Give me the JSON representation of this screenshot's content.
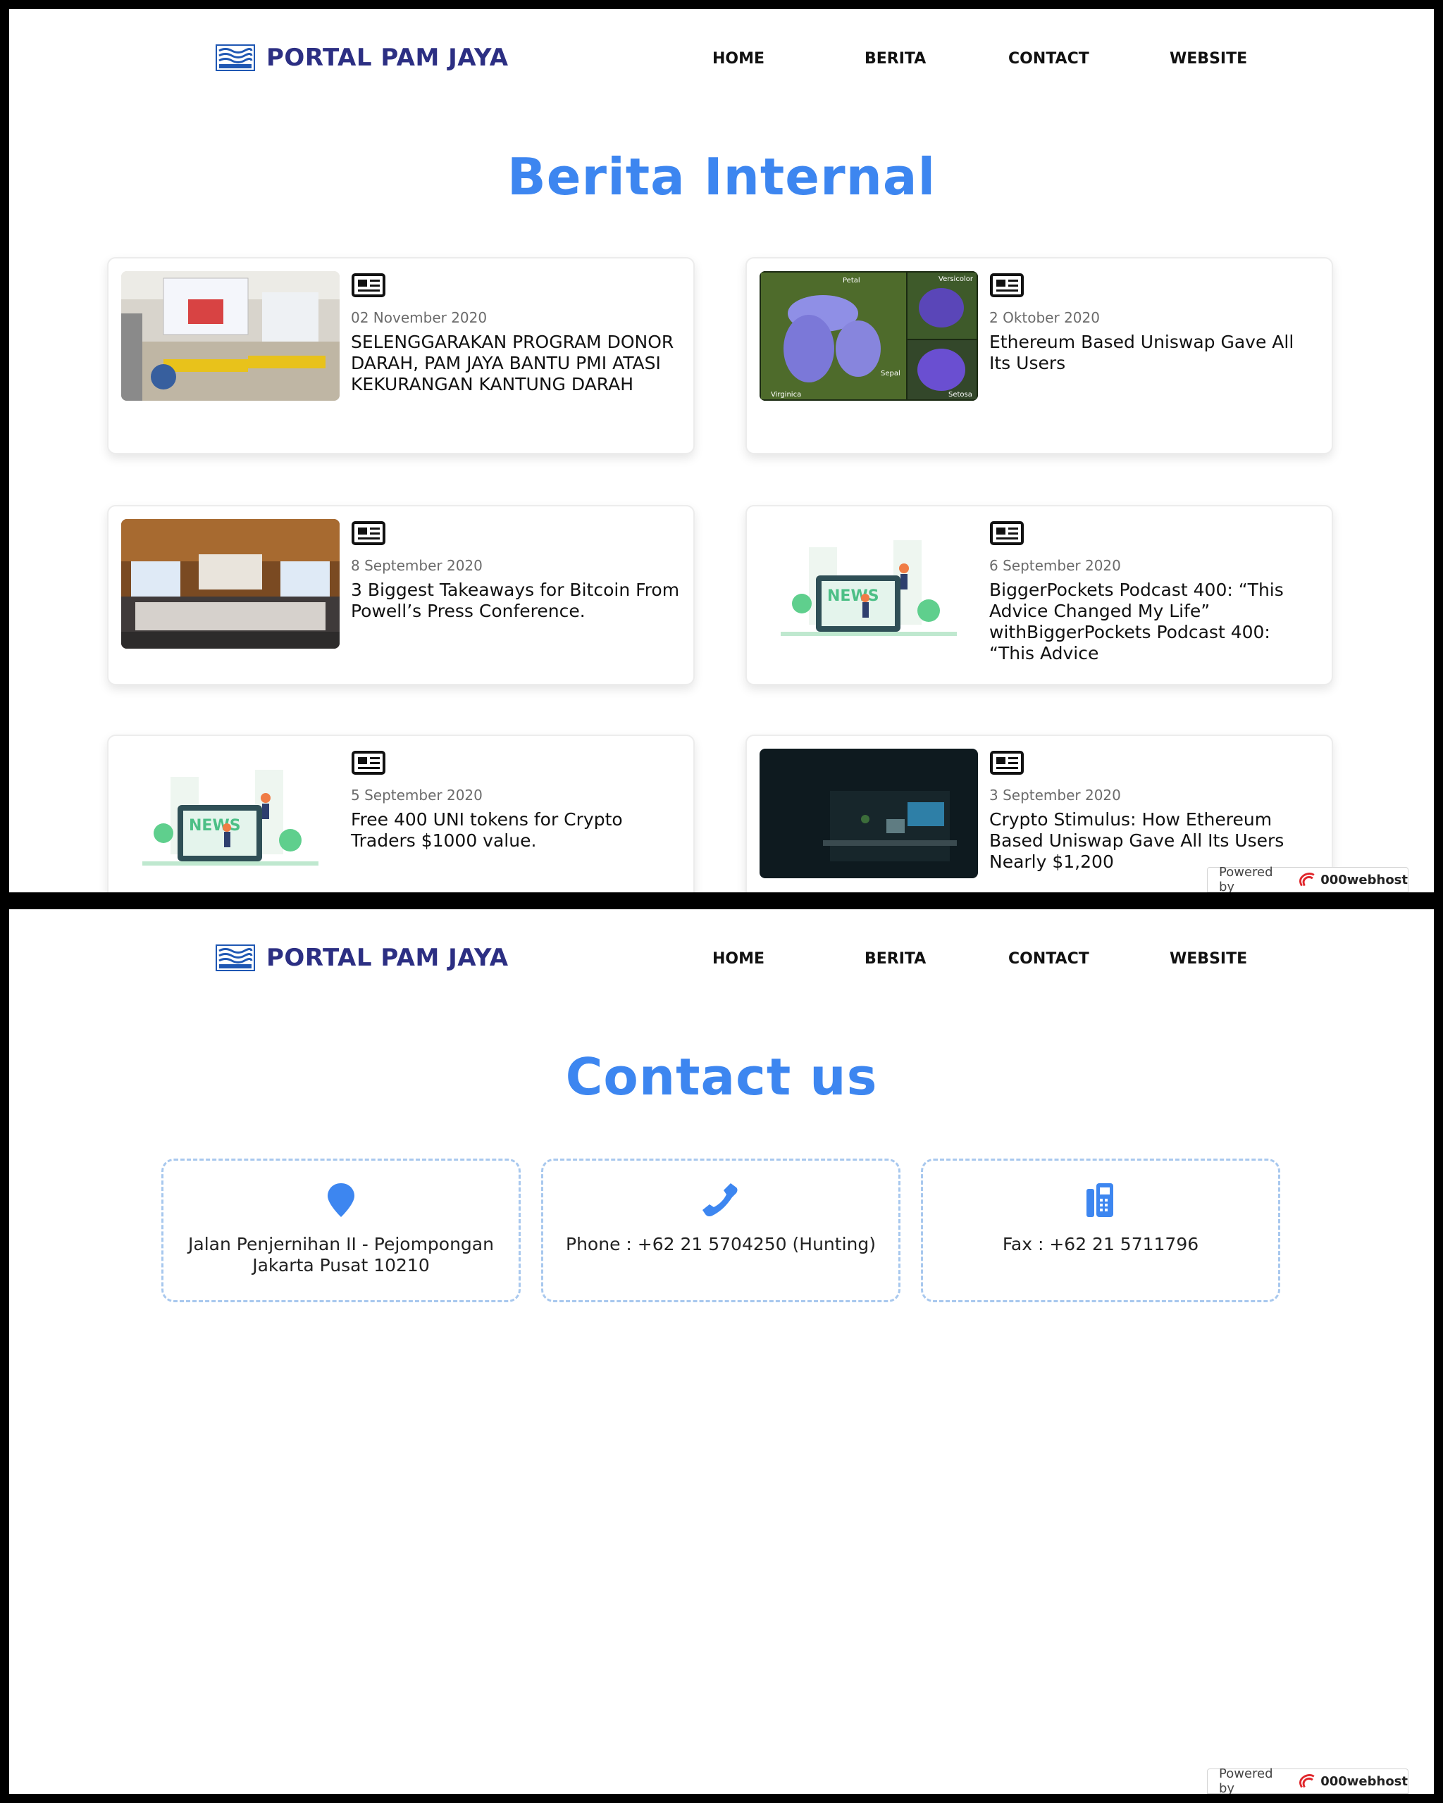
{
  "brand": {
    "title": "PORTAL PAM JAYA"
  },
  "nav": [
    {
      "label": "HOME"
    },
    {
      "label": "BERITA"
    },
    {
      "label": "CONTACT"
    },
    {
      "label": "WEBSITE"
    }
  ],
  "news_section": {
    "title": "Berita Internal",
    "items": [
      {
        "date": "02 November 2020",
        "title": "SELENGGARAKAN PROGRAM DONOR DARAH, PAM JAYA BANTU PMI ATASI KEKURANGAN KANTUNG DARAH",
        "icon": "newspaper-icon"
      },
      {
        "date": "2 Oktober 2020",
        "title": "Ethereum Based Uniswap Gave All Its Users",
        "icon": "newspaper-icon",
        "image_labels": [
          "Petal",
          "Versicolor",
          "Sepal",
          "Virginica",
          "Setosa"
        ]
      },
      {
        "date": "8 September 2020",
        "title": "3 Biggest Takeaways for Bitcoin From Powell’s Press Conference.",
        "icon": "newspaper-icon"
      },
      {
        "date": "6 September 2020",
        "title": "BiggerPockets Podcast 400: “This Advice Changed My Life” withBiggerPockets Podcast 400: “This Advice",
        "icon": "newspaper-icon",
        "image_label": "NEWS"
      },
      {
        "date": "5 September 2020",
        "title": "Free 400 UNI tokens for Crypto Traders $1000 value.",
        "icon": "newspaper-icon",
        "image_label": "NEWS"
      },
      {
        "date": "3 September 2020",
        "title": "Crypto Stimulus: How Ethereum Based Uniswap Gave All Its Users Nearly $1,200",
        "icon": "newspaper-icon"
      }
    ]
  },
  "contact_section": {
    "title": "Contact us",
    "items": [
      {
        "icon": "map-pin-icon",
        "text": "Jalan Penjernihan II - Pejompongan Jakarta Pusat 10210"
      },
      {
        "icon": "phone-icon",
        "text": "Phone : +62 21 5704250 (Hunting)"
      },
      {
        "icon": "fax-icon",
        "text": "Fax : +62 21 5711796"
      }
    ]
  },
  "powered": {
    "label": "Powered by",
    "host": "000webhost"
  },
  "colors": {
    "accent": "#3d86f0",
    "brand": "#2c2f83",
    "dashed_border": "#a8c8ee"
  }
}
